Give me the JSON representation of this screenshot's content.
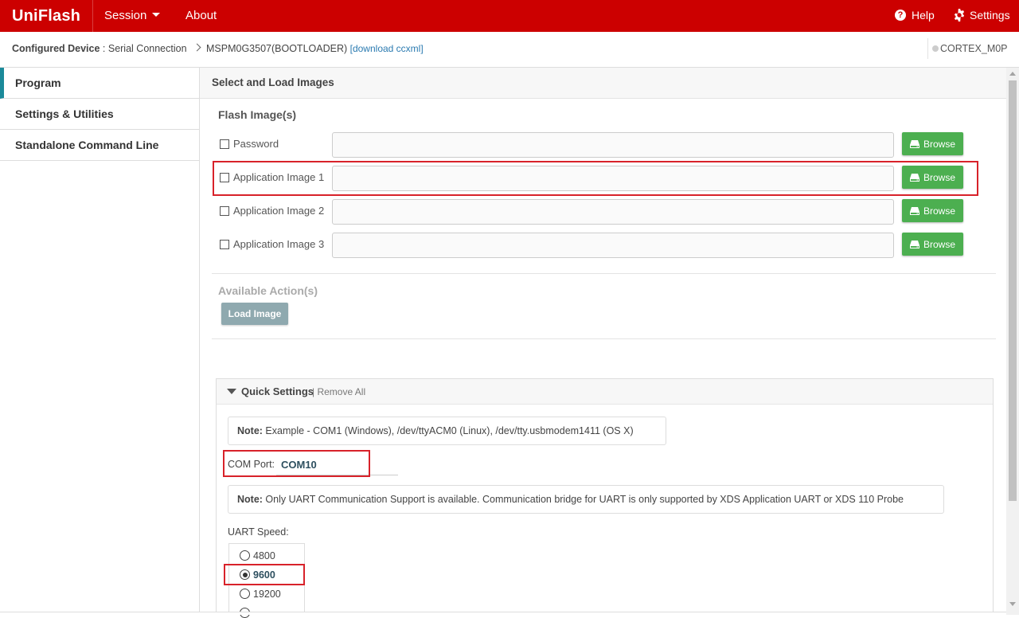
{
  "app": {
    "brand": "UniFlash"
  },
  "nav": {
    "session": "Session",
    "about": "About",
    "help": "Help",
    "settings": "Settings"
  },
  "breadcrumb": {
    "configured_label": "Configured Device",
    "connection": " : Serial Connection",
    "device": "MSPM0G3507(BOOTLOADER)",
    "download_link": "[download ccxml]",
    "core": "CORTEX_M0P"
  },
  "sidebar": {
    "items": [
      {
        "label": "Program",
        "active": true
      },
      {
        "label": "Settings & Utilities",
        "active": false
      },
      {
        "label": "Standalone Command Line",
        "active": false
      }
    ]
  },
  "main": {
    "title": "Select and Load Images",
    "flash_title": "Flash Image(s)",
    "images": [
      {
        "label": "Password",
        "value": "",
        "checked": false,
        "browse": "Browse"
      },
      {
        "label": "Application Image 1",
        "value": "",
        "checked": false,
        "browse": "Browse"
      },
      {
        "label": "Application Image 2",
        "value": "",
        "checked": false,
        "browse": "Browse"
      },
      {
        "label": "Application Image 3",
        "value": "",
        "checked": false,
        "browse": "Browse"
      }
    ],
    "actions_title": "Available Action(s)",
    "load_button": "Load Image"
  },
  "quick_settings": {
    "title": "Quick Settings",
    "remove_all": "| Remove All",
    "note1_bold": "Note:",
    "note1_text": " Example - COM1 (Windows), /dev/ttyACM0 (Linux), /dev/tty.usbmodem1411 (OS X)",
    "com_port_label": "COM Port:",
    "com_port_value": "COM10",
    "note2_bold": "Note:",
    "note2_text": " Only UART Communication Support is available. Communication bridge for UART is only supported by XDS Application UART or XDS 110 Probe",
    "uart_speed_label": "UART Speed:",
    "uart_options": [
      {
        "label": "4800",
        "checked": false
      },
      {
        "label": "9600",
        "checked": true
      },
      {
        "label": "19200",
        "checked": false
      }
    ]
  },
  "colors": {
    "topbar": "#cc0000",
    "browse": "#4caf50",
    "highlight": "#d8222a",
    "active_accent": "#1b8a9a"
  }
}
